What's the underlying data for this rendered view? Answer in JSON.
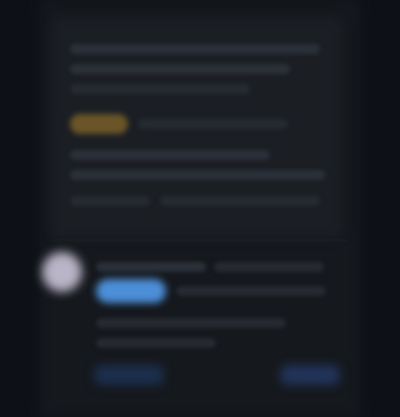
{
  "colors": {
    "background": "#0f1318",
    "panel": "#15181d",
    "card": "#1b1f24",
    "accent_amber": "#6b5528",
    "accent_blue": "#4c8fd8",
    "avatar": "#b9b4c6"
  }
}
